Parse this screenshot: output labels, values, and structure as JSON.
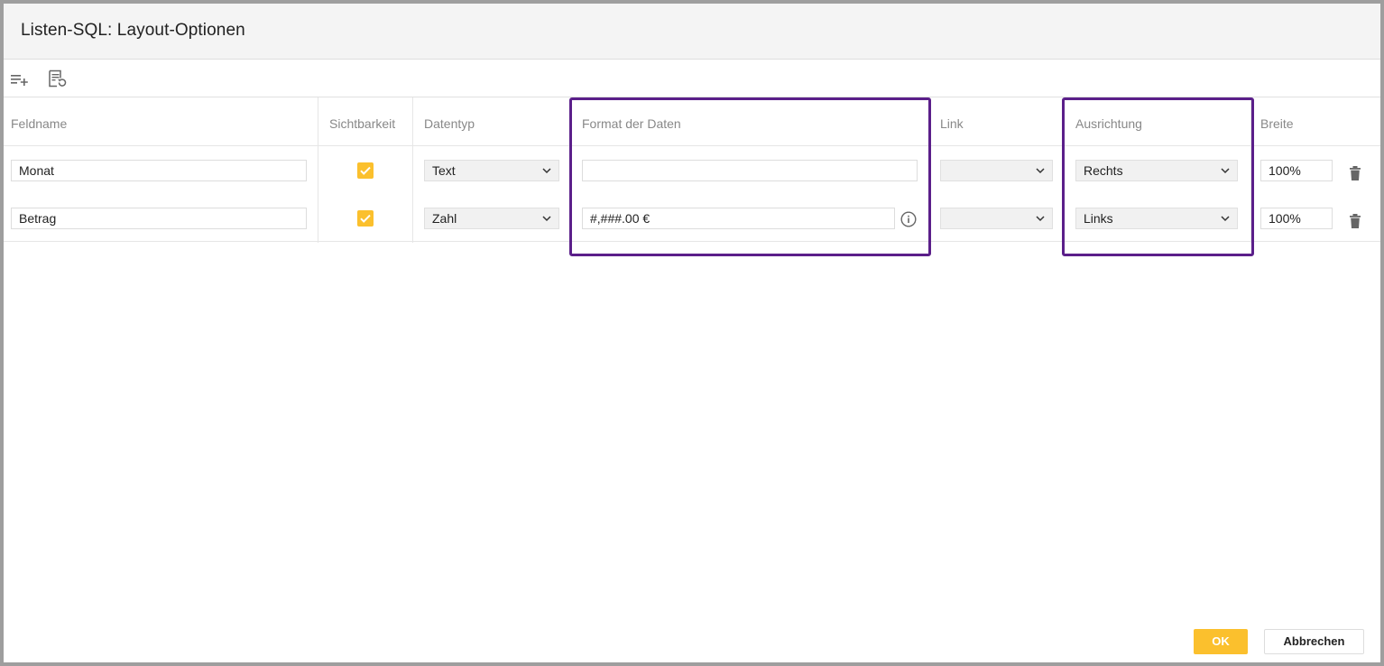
{
  "dialog": {
    "title": "Listen-SQL: Layout-Optionen"
  },
  "toolbar": {
    "add_row_icon": "playlist-add-icon",
    "reset_icon": "list-reset-icon"
  },
  "columns": {
    "feldname": "Feldname",
    "sichtbarkeit": "Sichtbarkeit",
    "datentyp": "Datentyp",
    "format": "Format der Daten",
    "link": "Link",
    "ausrichtung": "Ausrichtung",
    "breite": "Breite"
  },
  "rows": [
    {
      "feldname": "Monat",
      "sichtbar": true,
      "datentyp": "Text",
      "format": "",
      "link": "",
      "ausrichtung": "Rechts",
      "breite": "100%"
    },
    {
      "feldname": "Betrag",
      "sichtbar": true,
      "datentyp": "Zahl",
      "format": "#,###.00 €",
      "link": "",
      "ausrichtung": "Links",
      "breite": "100%"
    }
  ],
  "buttons": {
    "ok": "OK",
    "cancel": "Abbrechen"
  },
  "colors": {
    "accent": "#fbc02d",
    "highlight": "#5b1f8a"
  }
}
